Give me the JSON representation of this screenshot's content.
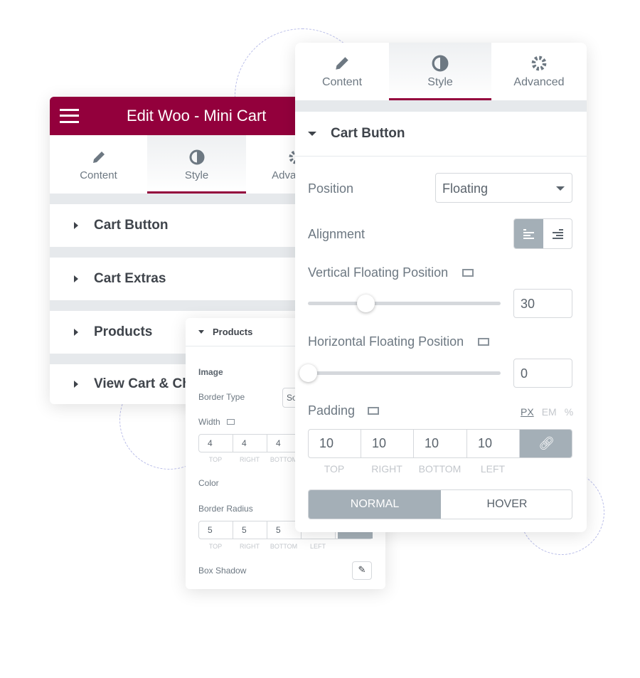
{
  "back_panel": {
    "title": "Edit Woo - Mini Cart",
    "tabs": [
      "Content",
      "Style",
      "Advanced"
    ],
    "sections": [
      "Cart Button",
      "Cart Extras",
      "Products",
      "View Cart & Checkout"
    ]
  },
  "middle_panel": {
    "section": "Products",
    "image_label": "Image",
    "border_type_label": "Border Type",
    "border_type_value": "Solid",
    "width_label": "Width",
    "width_values": [
      "4",
      "4",
      "4"
    ],
    "dimension_labels": [
      "TOP",
      "RIGHT",
      "BOTTOM",
      "LEFT"
    ],
    "color_label": "Color",
    "border_radius_label": "Border Radius",
    "radius_values": [
      "5",
      "5",
      "5"
    ],
    "box_shadow_label": "Box Shadow"
  },
  "front_panel": {
    "tabs": [
      "Content",
      "Style",
      "Advanced"
    ],
    "section": "Cart Button",
    "position_label": "Position",
    "position_value": "Floating",
    "alignment_label": "Alignment",
    "alignment_selected": "left",
    "vertical_label": "Vertical Floating Position",
    "vertical_value": "30",
    "horizontal_label": "Horizontal Floating Position",
    "horizontal_value": "0",
    "padding_label": "Padding",
    "units": [
      "PX",
      "EM",
      "%"
    ],
    "unit_selected": "PX",
    "padding_values": [
      "10",
      "10",
      "10",
      "10"
    ],
    "padding_labels": [
      "TOP",
      "RIGHT",
      "BOTTOM",
      "LEFT"
    ],
    "state_tabs": [
      "NORMAL",
      "HOVER"
    ],
    "state_selected": "NORMAL"
  },
  "colors": {
    "brand": "#93003c",
    "active_control": "#a4afb7"
  }
}
